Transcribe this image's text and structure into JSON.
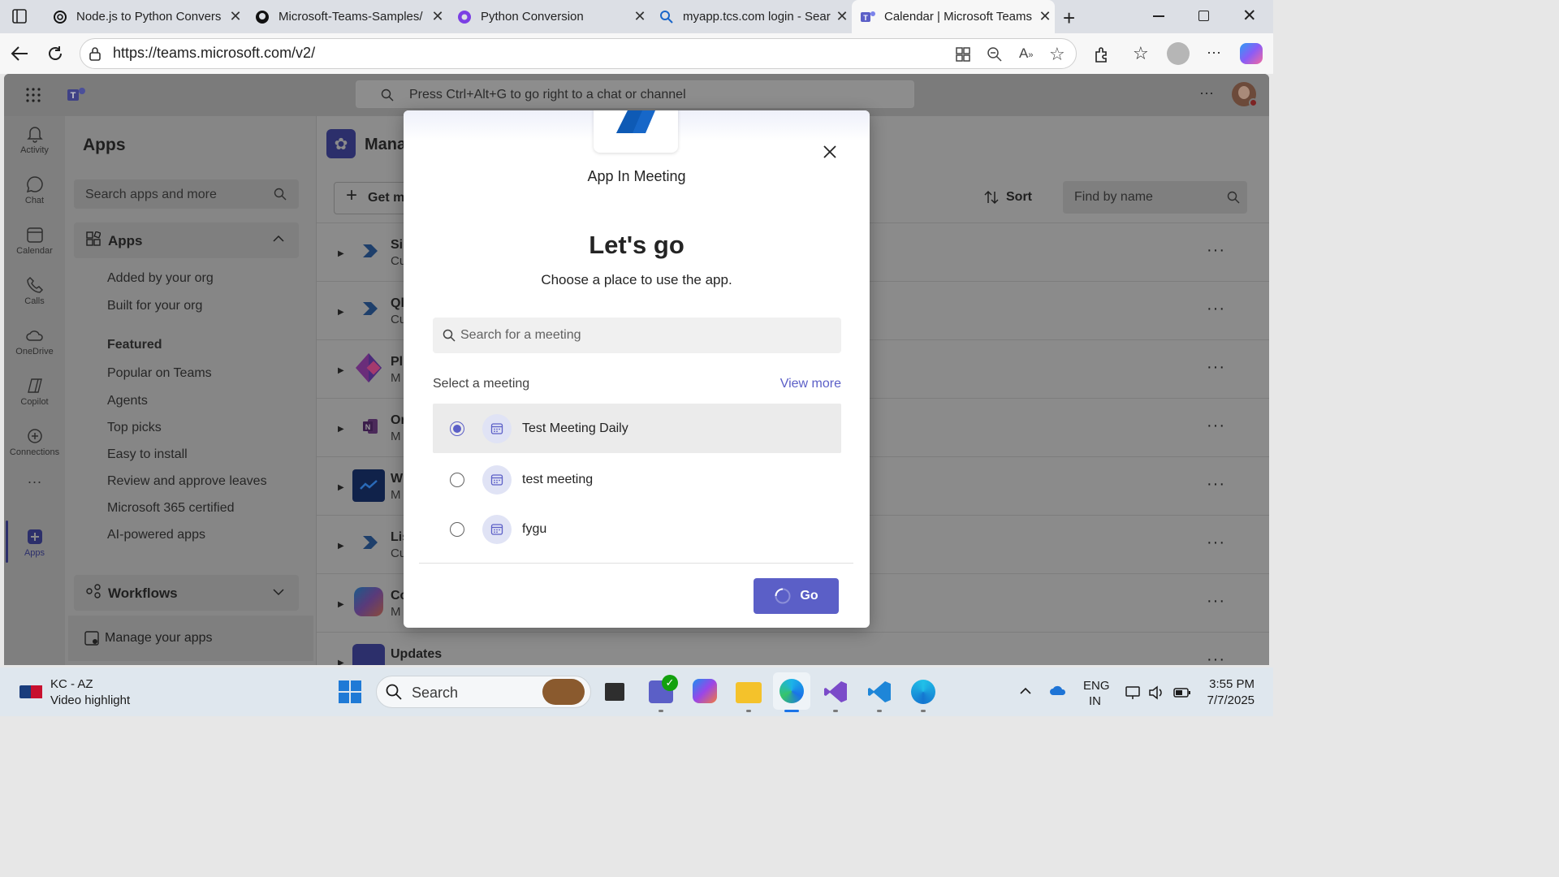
{
  "browser": {
    "tabs": [
      {
        "title": "Node.js to Python Convers",
        "icon": "chatgpt-icon"
      },
      {
        "title": "Microsoft-Teams-Samples/",
        "icon": "github-icon"
      },
      {
        "title": "Python Conversion",
        "icon": "copilot-icon"
      },
      {
        "title": "myapp.tcs.com login - Sear",
        "icon": "search-icon"
      },
      {
        "title": "Calendar | Microsoft Teams",
        "icon": "teams-icon",
        "active": true
      }
    ],
    "url": "https://teams.microsoft.com/v2/"
  },
  "teams": {
    "search_placeholder": "Press Ctrl+Alt+G to go right to a chat or channel",
    "rail": [
      "Activity",
      "Chat",
      "Calendar",
      "Calls",
      "OneDrive",
      "Copilot",
      "Connections",
      "Apps"
    ],
    "rail_more": "···",
    "apps_panel": {
      "title": "Apps",
      "search_placeholder": "Search apps and more",
      "section_apps": "Apps",
      "items_top": [
        "Added by your org",
        "Built for your org"
      ],
      "featured_label": "Featured",
      "featured_items": [
        "Popular on Teams",
        "Agents",
        "Top picks",
        "Easy to install",
        "Review and approve leaves",
        "Microsoft 365 certified",
        "AI-powered apps"
      ],
      "section_workflows": "Workflows",
      "manage_apps": "Manage your apps"
    },
    "main": {
      "header_title": "Mana",
      "get_more": "Get m",
      "sort_label": "Sort",
      "find_placeholder": "Find by name",
      "rows": [
        {
          "name": "Si",
          "sub": "Cu"
        },
        {
          "name": "Ql",
          "sub": "Cu"
        },
        {
          "name": "Pl",
          "sub": "M"
        },
        {
          "name": "Or",
          "sub": "M"
        },
        {
          "name": "W",
          "sub": "M"
        },
        {
          "name": "Lis",
          "sub": "Cu"
        },
        {
          "name": "Co",
          "sub": "M"
        },
        {
          "name": "Updates",
          "sub": ""
        }
      ]
    }
  },
  "modal": {
    "app_name": "App In Meeting",
    "heading": "Let's go",
    "subheading": "Choose a place to use the app.",
    "search_placeholder": "Search for a meeting",
    "select_label": "Select a meeting",
    "view_more": "View more",
    "meetings": [
      {
        "name": "Test Meeting Daily",
        "selected": true
      },
      {
        "name": "test meeting",
        "selected": false
      },
      {
        "name": "fygu",
        "selected": false
      }
    ],
    "go_label": "Go",
    "accent": "#5b5fc7"
  },
  "taskbar": {
    "weather_title": "KC - AZ",
    "weather_sub": "Video highlight",
    "search_label": "Search",
    "lang_top": "ENG",
    "lang_bottom": "IN",
    "time": "3:55 PM",
    "date": "7/7/2025"
  }
}
